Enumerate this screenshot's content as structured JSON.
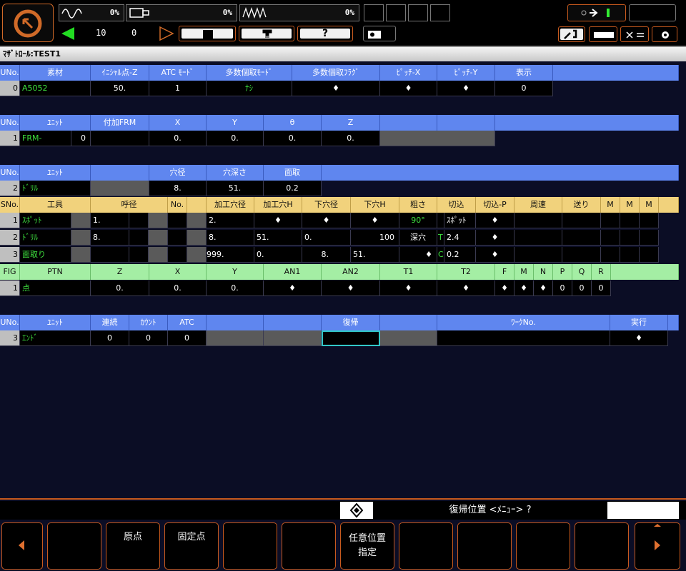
{
  "top": {
    "meter1_pct": "0%",
    "meter2_pct": "0%",
    "meter3_pct": "0%",
    "counter_a": "10",
    "counter_b": "0",
    "help_label": "?",
    "key_count": "0"
  },
  "title": "ﾏｻﾞﾄﾛｰﾙ:TEST1",
  "colors": {
    "header_blue": "#5f86ef",
    "header_yellow": "#f1d27c",
    "header_green": "#a4eea4",
    "accent_orange": "#c85a1e",
    "text_green": "#3ee03e",
    "select_cyan": "#32c8c8"
  },
  "material_table": {
    "headers": [
      "UNo.",
      "素材",
      "ｲﾆｼｬﾙ点-Z",
      "ATC ﾓｰﾄﾞ",
      "多数個取ﾓｰﾄﾞ",
      "多数個取ﾌﾗｸﾞ",
      "ﾋﾟｯﾁ-X",
      "ﾋﾟｯﾁ-Y",
      "表示"
    ],
    "row": [
      "0",
      "A5052",
      "50.",
      "1",
      "ﾅｼ",
      "♦",
      "♦",
      "♦",
      "0"
    ]
  },
  "frm_table": {
    "headers": [
      "UNo.",
      "ﾕﾆｯﾄ",
      "付加FRM",
      "X",
      "Y",
      "θ",
      "Z"
    ],
    "row": [
      "1",
      "FRM-",
      "0",
      "0.",
      "0.",
      "0.",
      "0."
    ]
  },
  "drill_table": {
    "headers": [
      "UNo.",
      "ﾕﾆｯﾄ",
      "",
      "穴径",
      "穴深さ",
      "面取"
    ],
    "row": [
      "2",
      "ﾄﾞﾘﾙ",
      "",
      "8.",
      "51.",
      "0.2"
    ]
  },
  "tool_table": {
    "headers": [
      "SNo.",
      "工具",
      "呼径",
      "No.",
      "加工穴径",
      "加工穴H",
      "下穴径",
      "下穴H",
      "粗さ",
      "切込",
      "切込-P",
      "周速",
      "送り",
      "M",
      "M",
      "M"
    ],
    "rows": [
      {
        "no": "1",
        "tool": "ｽﾎﾟｯﾄ",
        "dia": "1.",
        "hole_dia": "2.",
        "hole_h": "♦",
        "pre_dia": "♦",
        "pre_h": "♦",
        "rough": "90°",
        "cut_mark": "",
        "cut": "ｽﾎﾟｯﾄ",
        "cut_p": "♦"
      },
      {
        "no": "2",
        "tool": "ﾄﾞﾘﾙ",
        "dia": "8.",
        "hole_dia": "8.",
        "hole_h": "51.",
        "pre_dia": "0.",
        "pre_h": "100",
        "rough": "深穴",
        "cut_mark": "T",
        "cut": "2.4",
        "cut_p": "♦"
      },
      {
        "no": "3",
        "tool": "面取り",
        "dia": "",
        "hole_dia": "999.",
        "hole_h": "0.",
        "pre_dia": "8.",
        "pre_h": "51.",
        "rough": "♦",
        "cut_mark": "C",
        "cut": "0.2",
        "cut_p": "♦"
      }
    ]
  },
  "fig_table": {
    "headers": [
      "FIG",
      "PTN",
      "Z",
      "X",
      "Y",
      "AN1",
      "AN2",
      "T1",
      "T2",
      "F",
      "M",
      "N",
      "P",
      "Q",
      "R"
    ],
    "row": [
      "1",
      "点",
      "0.",
      "0.",
      "0.",
      "♦",
      "♦",
      "♦",
      "♦",
      "♦",
      "♦",
      "♦",
      "0",
      "0",
      "0"
    ]
  },
  "end_table": {
    "headers": [
      "UNo.",
      "ﾕﾆｯﾄ",
      "連続",
      "ｶｳﾝﾄ",
      "ATC",
      "",
      "",
      "復帰",
      "",
      "ﾜｰｸNo.",
      "実行"
    ],
    "row": [
      "3",
      "ｴﾝﾄﾞ",
      "0",
      "0",
      "0",
      "",
      "",
      "",
      "",
      "",
      "♦"
    ]
  },
  "status": {
    "prompt": "復帰位置 <ﾒﾆｭｰ> ?"
  },
  "fkeys": [
    "",
    "",
    "原点",
    "固定点",
    "",
    "",
    "任意位置\n指定",
    "",
    "",
    "",
    "",
    ""
  ]
}
